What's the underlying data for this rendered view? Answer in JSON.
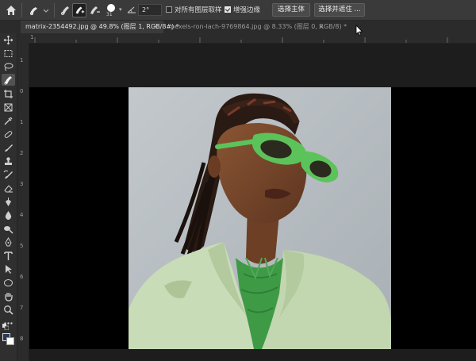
{
  "options_bar": {
    "home_icon": "home-icon",
    "brush_size": "31",
    "angle": "2°",
    "sample_all_layers_label": "对所有图层取样",
    "sample_all_layers_checked": false,
    "enhance_edge_label": "增强边缘",
    "enhance_edge_checked": true,
    "select_subject_label": "选择主体",
    "select_and_mask_label": "选择并遮住 ..."
  },
  "tabs": [
    {
      "label": "matrix-2354492.jpg @ 49.8% (图层 1, RGB/8#) *",
      "close": "×",
      "active": true
    },
    {
      "label": "pexels-ron-lach-9769864.jpg @ 8.33% (图层 0, RGB/8) *",
      "close": "×",
      "active": false
    }
  ],
  "ruler_left_numbers": [
    "1",
    "0",
    "1",
    "2",
    "3",
    "4",
    "5",
    "6",
    "7",
    "8",
    "9"
  ],
  "ruler_top_numbers": [
    "1"
  ],
  "colors": {
    "foreground": "#2b3a58",
    "background": "#ffffff",
    "glasses": "#5cc35a",
    "jacket": "#c9dcb8",
    "backdrop": "#b9bfc3"
  },
  "toolbar_icons": [
    "move-tool-icon",
    "marquee-tool-icon",
    "lasso-tool-icon",
    "quick-selection-tool-icon",
    "crop-tool-icon",
    "frame-tool-icon",
    "eyedropper-tool-icon",
    "healing-brush-icon",
    "brush-tool-icon",
    "clone-stamp-icon",
    "history-brush-icon",
    "eraser-tool-icon",
    "gradient-tool-icon",
    "blur-tool-icon",
    "dodge-tool-icon",
    "pen-tool-icon",
    "type-tool-icon",
    "path-selection-icon",
    "rectangle-tool-icon",
    "hand-tool-icon",
    "zoom-tool-icon",
    "more-tools-icon"
  ]
}
